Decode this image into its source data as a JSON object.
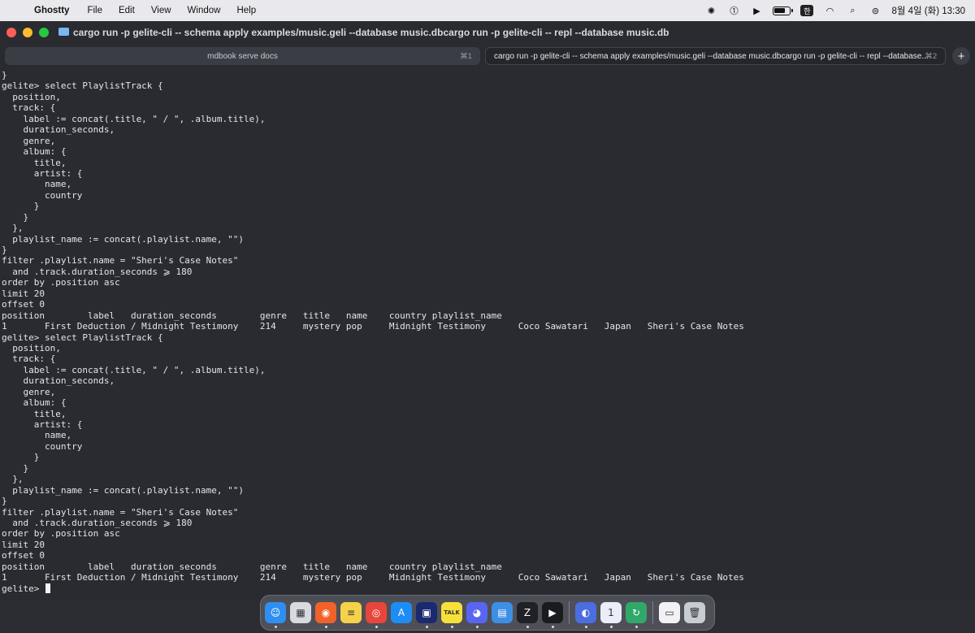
{
  "menubar": {
    "app_name": "Ghostty",
    "menus": [
      "File",
      "Edit",
      "View",
      "Window",
      "Help"
    ],
    "input_badge": "한",
    "datetime": "8월 4일 (화) 13:30"
  },
  "window": {
    "title": "cargo run -p gelite-cli -- schema apply examples/music.geli --database music.dbcargo run -p gelite-cli -- repl --database music.db",
    "tabs": [
      {
        "label": "mdbook serve docs",
        "shortcut": "⌘1",
        "active": false
      },
      {
        "label": "cargo run -p gelite-cli -- schema apply examples/music.geli --database music.dbcargo run -p gelite-cli -- repl --database...",
        "shortcut": "⌘2",
        "active": true
      }
    ],
    "new_tab_label": "+"
  },
  "terminal": {
    "lines": [
      "}",
      "gelite> select PlaylistTrack {",
      "  position,",
      "  track: {",
      "    label := concat(.title, \" / \", .album.title),",
      "    duration_seconds,",
      "    genre,",
      "    album: {",
      "      title,",
      "      artist: {",
      "        name,",
      "        country",
      "      }",
      "    }",
      "  },",
      "  playlist_name := concat(.playlist.name, \"\")",
      "}",
      "filter .playlist.name = \"Sheri's Case Notes\"",
      "  and .track.duration_seconds ⩾ 180",
      "order by .position asc",
      "limit 20",
      "offset 0",
      "position        label   duration_seconds        genre   title   name    country playlist_name",
      "1       First Deduction / Midnight Testimony    214     mystery pop     Midnight Testimony      Coco Sawatari   Japan   Sheri's Case Notes",
      "gelite> select PlaylistTrack {",
      "  position,",
      "  track: {",
      "    label := concat(.title, \" / \", .album.title),",
      "    duration_seconds,",
      "    genre,",
      "    album: {",
      "      title,",
      "      artist: {",
      "        name,",
      "        country",
      "      }",
      "    }",
      "  },",
      "  playlist_name := concat(.playlist.name, \"\")",
      "}",
      "filter .playlist.name = \"Sheri's Case Notes\"",
      "  and .track.duration_seconds ⩾ 180",
      "order by .position asc",
      "limit 20",
      "offset 0",
      "position        label   duration_seconds        genre   title   name    country playlist_name",
      "1       First Deduction / Midnight Testimony    214     mystery pop     Midnight Testimony      Coco Sawatari   Japan   Sheri's Case Notes"
    ],
    "prompt": "gelite> "
  },
  "dock": {
    "apps": [
      {
        "icon": "finder-icon",
        "glyph": "☺",
        "color": "#2f8ff0",
        "running": true
      },
      {
        "icon": "launchpad-icon",
        "glyph": "▦",
        "color": "#d9d9e0",
        "running": false
      },
      {
        "icon": "firefox-icon",
        "glyph": "◉",
        "color": "#f0622a",
        "running": true
      },
      {
        "icon": "notes-icon",
        "glyph": "≡",
        "color": "#f5d24a",
        "running": false
      },
      {
        "icon": "chrome-icon",
        "glyph": "◎",
        "color": "#e8453c",
        "running": true
      },
      {
        "icon": "app-store-icon",
        "glyph": "A",
        "color": "#1e8cf5",
        "running": false
      },
      {
        "icon": "toolbox-icon",
        "glyph": "▣",
        "color": "#1b2a6e",
        "running": true
      },
      {
        "icon": "kakaotalk-icon",
        "glyph": "TALK",
        "color": "#f8e03a",
        "running": true
      },
      {
        "icon": "discord-icon",
        "glyph": "◕",
        "color": "#5865f2",
        "running": true
      },
      {
        "icon": "files-icon",
        "glyph": "▤",
        "color": "#3d8fe6",
        "running": false
      },
      {
        "icon": "zed-icon",
        "glyph": "Z",
        "color": "#202126",
        "running": true
      },
      {
        "icon": "ghostty-icon",
        "glyph": "▶",
        "color": "#1a1b1f",
        "running": true
      },
      {
        "icon": "preview-icon",
        "glyph": "◐",
        "color": "#4a6ee0",
        "running": true
      },
      {
        "icon": "1password-icon",
        "glyph": "1",
        "color": "#e9eef8",
        "running": true
      },
      {
        "icon": "sync-icon",
        "glyph": "↻",
        "color": "#2fa86a",
        "running": true
      },
      {
        "icon": "downloads-stack-icon",
        "glyph": "▭",
        "color": "#f2f2f4",
        "running": false
      },
      {
        "icon": "trash-icon",
        "glyph": "🗑",
        "color": "#c9ccd3",
        "running": false
      }
    ]
  }
}
